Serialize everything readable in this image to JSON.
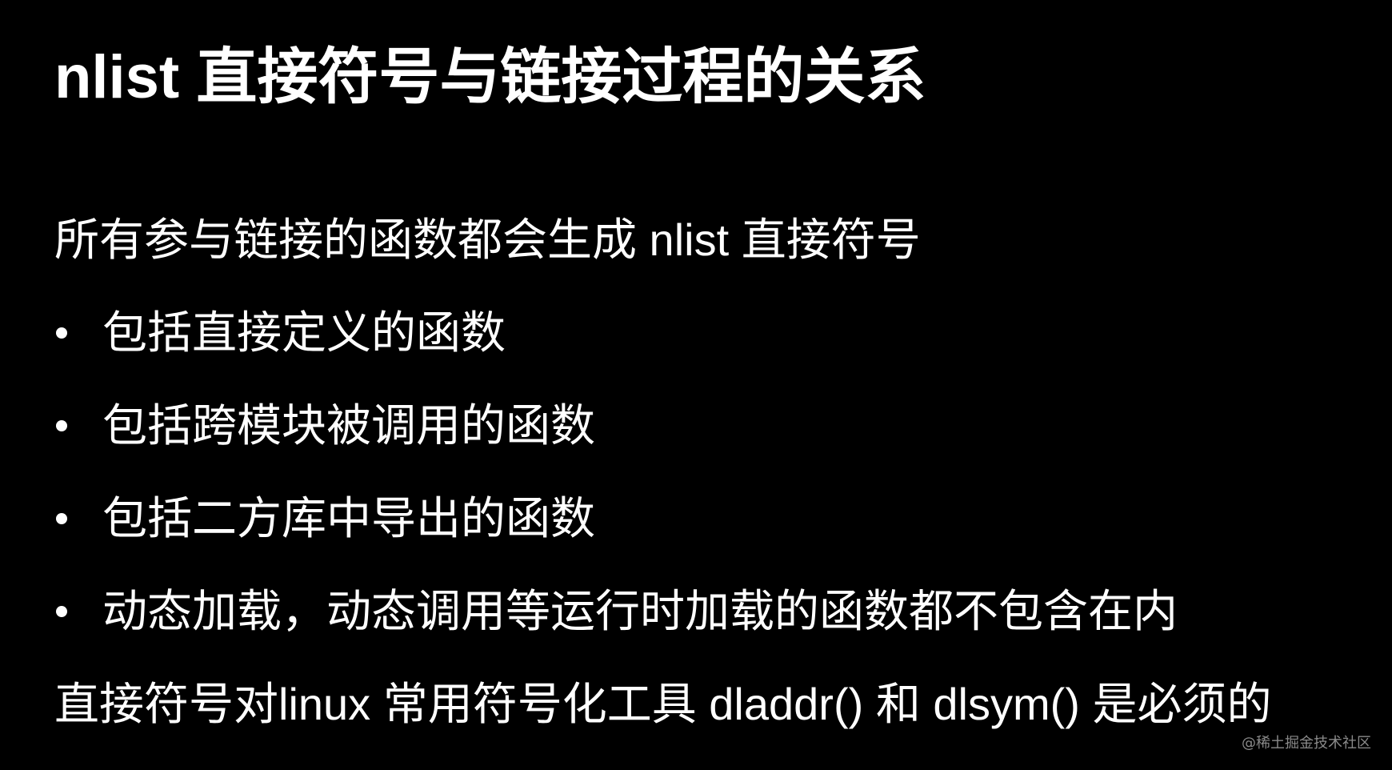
{
  "slide": {
    "title": "nlist 直接符号与链接过程的关系",
    "intro": "所有参与链接的函数都会生成 nlist 直接符号",
    "bullets": [
      "包括直接定义的函数",
      "包括跨模块被调用的函数",
      "包括二方库中导出的函数",
      "动态加载，动态调用等运行时加载的函数都不包含在内"
    ],
    "conclusion": "直接符号对linux 常用符号化工具 dladdr() 和 dlsym() 是必须的"
  },
  "watermark": "@稀土掘金技术社区",
  "colors": {
    "background": "#000000",
    "text": "#ffffff",
    "watermark": "#8a8a8a"
  }
}
